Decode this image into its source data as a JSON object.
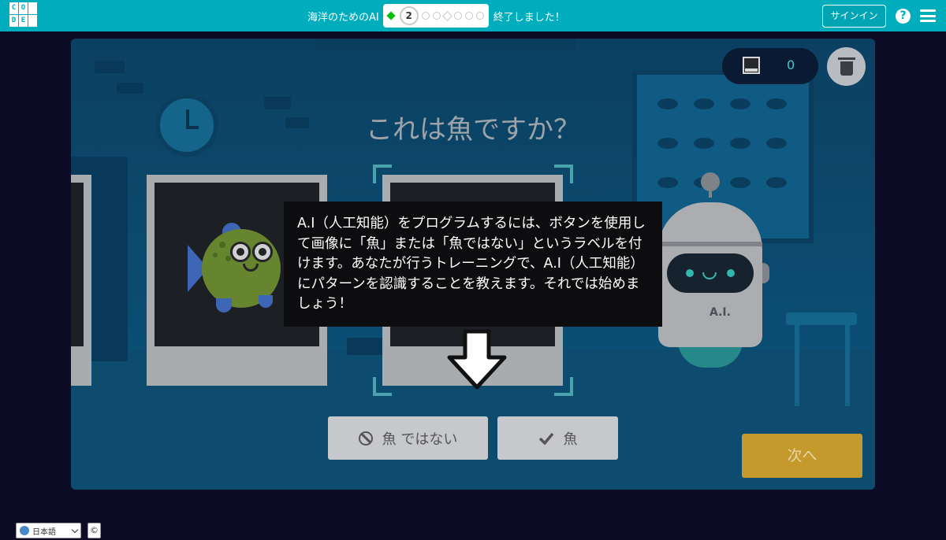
{
  "header": {
    "logo_letters": [
      "C",
      "O",
      "",
      "D",
      "E",
      ""
    ],
    "course_title": "海洋のためのAI",
    "current_level": "2",
    "finished_text": "終了しました！",
    "signin_label": "サインイン",
    "help_label": "?"
  },
  "stage": {
    "question": "これは魚ですか？",
    "counter_value": "0",
    "instructions": "A.I（人工知能）をプログラムするには、ボタンを使用して画像に「魚」または「魚ではない」というラベルを付けます。あなたが行うトレーニングで、A.I（人工知能）にパターンを認識することを教えます。それでは始めましょう！",
    "not_fish_label": "魚 ではない",
    "fish_label": "魚",
    "next_label": "次へ",
    "robot_label": "A.I."
  },
  "footer": {
    "language": "日本語",
    "copyright_label": "©"
  },
  "colors": {
    "header_bg": "#00adbc",
    "page_bg": "#0e0b26",
    "next_button": "#c49a2d",
    "counter_text": "#3dc7cf"
  }
}
